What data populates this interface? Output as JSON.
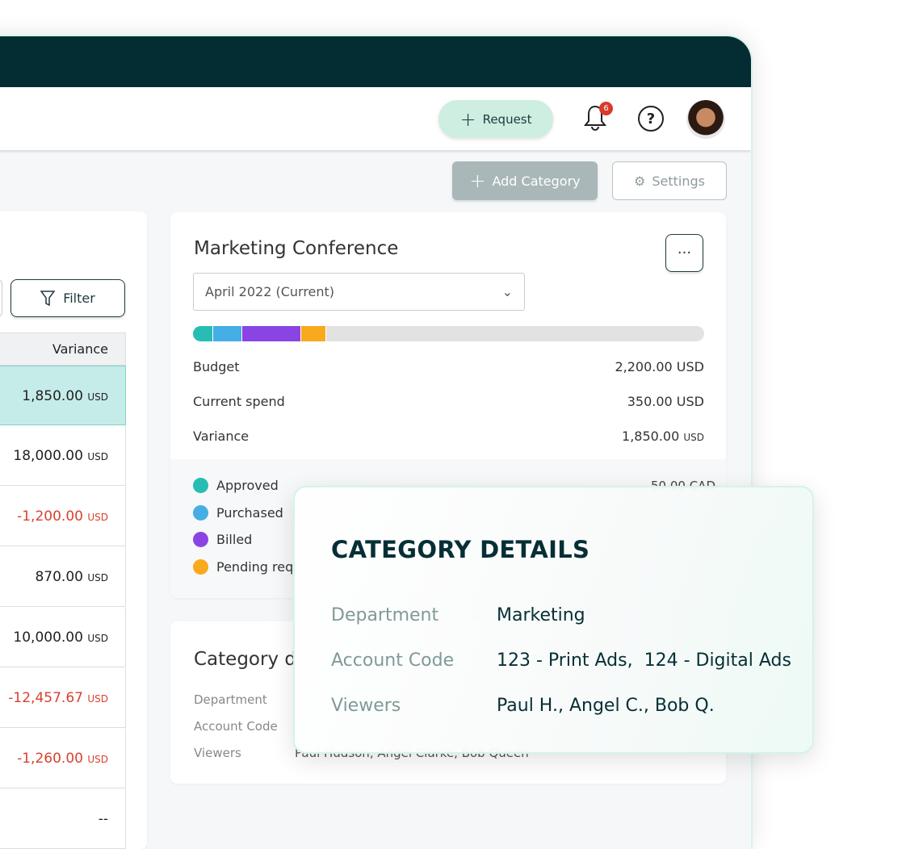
{
  "header": {
    "request_label": "Request",
    "notification_count": "6"
  },
  "toolbar": {
    "add_category_label": "Add Category",
    "settings_label": "Settings"
  },
  "table": {
    "filter_label": "Filter",
    "column": "Variance",
    "currency": "USD",
    "rows": [
      {
        "value": "1,850.00",
        "highlighted": true
      },
      {
        "value": "18,000.00"
      },
      {
        "value": "-1,200.00",
        "negative": true
      },
      {
        "value": "870.00"
      },
      {
        "value": "10,000.00"
      },
      {
        "value": "-12,457.67",
        "negative": true
      },
      {
        "value": "-1,260.00",
        "negative": true
      },
      {
        "value": "--"
      }
    ]
  },
  "category": {
    "title": "Marketing Conference",
    "period": "April 2022 (Current)",
    "progress": [
      {
        "status": "Approved",
        "color": "#27bdb5",
        "fraction": 0.04
      },
      {
        "status": "Purchased",
        "color": "#45aee4",
        "fraction": 0.057
      },
      {
        "status": "Billed",
        "color": "#8a44e4",
        "fraction": 0.114
      },
      {
        "status": "Pending",
        "color": "#f8a91c",
        "fraction": 0.05
      }
    ],
    "budget_label": "Budget",
    "budget_value": "2,200.00 USD",
    "spend_label": "Current spend",
    "spend_value": "350.00 USD",
    "variance_label": "Variance",
    "variance_value": "1,850.00",
    "variance_unit": "USD",
    "legend": [
      "Approved",
      "Purchased",
      "Billed",
      "Pending req"
    ],
    "legend_value": "50.00 CAD"
  },
  "details_card": {
    "title": "Category d",
    "department_label": "Department",
    "account_label": "Account Code",
    "viewers_label": "Viewers",
    "viewers_value": "Paul Hudson, Angel Clarke, Bob Queen"
  },
  "overlay": {
    "title": "CATEGORY DETAILS",
    "department_label": "Department",
    "department_value": "Marketing",
    "account_label": "Account Code",
    "account_value": "123 - Print Ads,  124 - Digital Ads",
    "viewers_label": "Viewers",
    "viewers_value": "Paul H., Angel C., Bob Q."
  }
}
